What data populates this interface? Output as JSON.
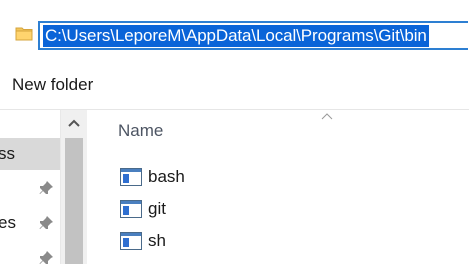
{
  "address_bar": {
    "path": "C:\\Users\\LeporeM\\AppData\\Local\\Programs\\Git\\bin"
  },
  "command_bar": {
    "new_folder_label": "New folder"
  },
  "navigation": {
    "items": [
      {
        "label": "ss",
        "selected": true,
        "pinned": false
      },
      {
        "label": "",
        "selected": false,
        "pinned": true
      },
      {
        "label": "es",
        "selected": false,
        "pinned": true
      },
      {
        "label": "",
        "selected": false,
        "pinned": true
      }
    ]
  },
  "file_list": {
    "column_header": "Name",
    "sort": "ascending",
    "files": [
      {
        "name": "bash",
        "icon": "application-icon"
      },
      {
        "name": "git",
        "icon": "application-icon"
      },
      {
        "name": "sh",
        "icon": "application-icon"
      }
    ]
  },
  "colors": {
    "selection": "#0a64d8",
    "focus_border": "#2d7fd2",
    "nav_selected": "#d9d9d9",
    "scrollbar_track": "#f0f0f0",
    "scrollbar_thumb": "#c2c2c2",
    "header_text": "#4d5563"
  }
}
